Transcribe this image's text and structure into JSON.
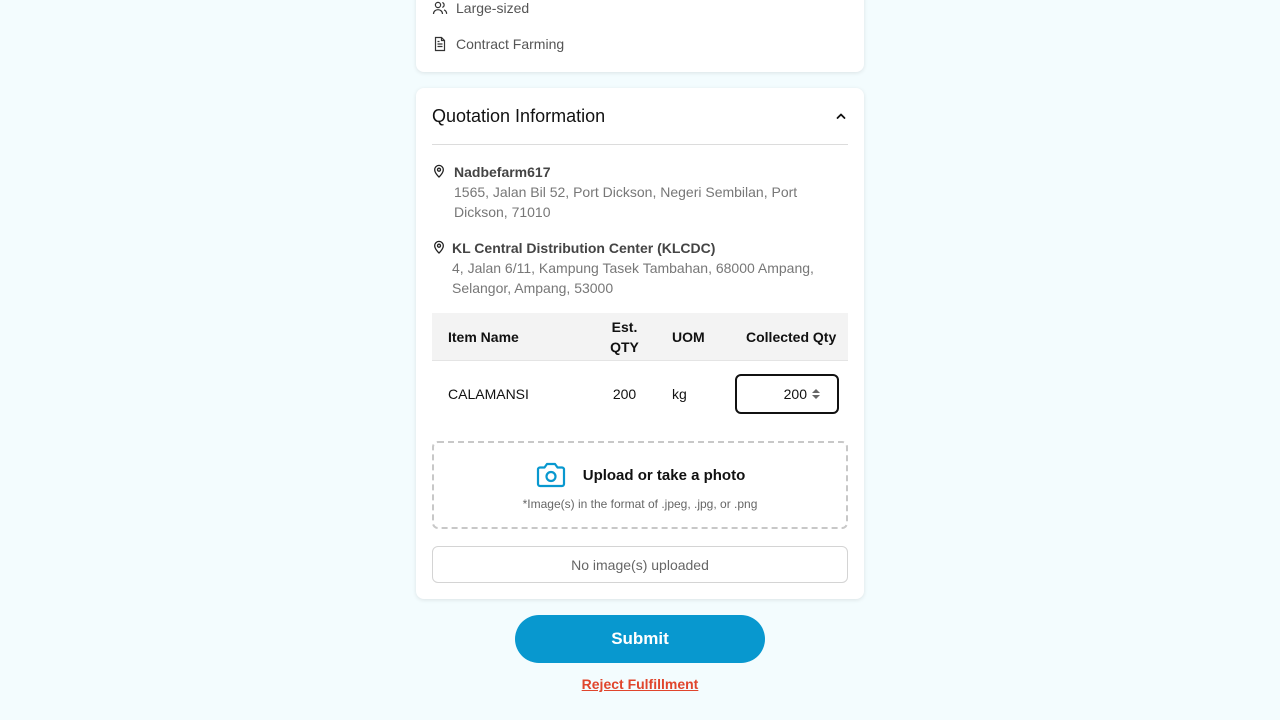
{
  "top_card": {
    "tags": [
      {
        "icon": "users-icon",
        "label": "Large-sized"
      },
      {
        "icon": "document-icon",
        "label": "Contract Farming"
      }
    ]
  },
  "quotation": {
    "title": "Quotation Information",
    "origin": {
      "name": "Nadbefarm617",
      "address_line1": "1565, Jalan Bil 52, Port Dickson, Negeri Sembilan, Port",
      "address_line2": "Dickson, 71010"
    },
    "destination": {
      "name": "KL Central Distribution Center (KLCDC)",
      "address_line1": "4, Jalan 6/11, Kampung Tasek Tambahan, 68000 Ampang,",
      "address_line2": "Selangor, Ampang, 53000"
    },
    "table": {
      "headers": {
        "item_name": "Item Name",
        "est_qty_1": "Est.",
        "est_qty_2": "QTY",
        "uom": "UOM",
        "collected_qty": "Collected Qty"
      },
      "rows": [
        {
          "item_name": "CALAMANSI",
          "est_qty": "200",
          "uom": "kg",
          "collected_qty": "200"
        }
      ]
    },
    "upload": {
      "label": "Upload or take a photo",
      "hint": "*Image(s) in the format of .jpeg, .jpg, or .png"
    },
    "no_images_text": "No image(s) uploaded"
  },
  "actions": {
    "submit_label": "Submit",
    "reject_label": "Reject Fulfillment"
  },
  "colors": {
    "background": "#f3fcfe",
    "accent": "#0898cf",
    "danger": "#e0452c"
  }
}
